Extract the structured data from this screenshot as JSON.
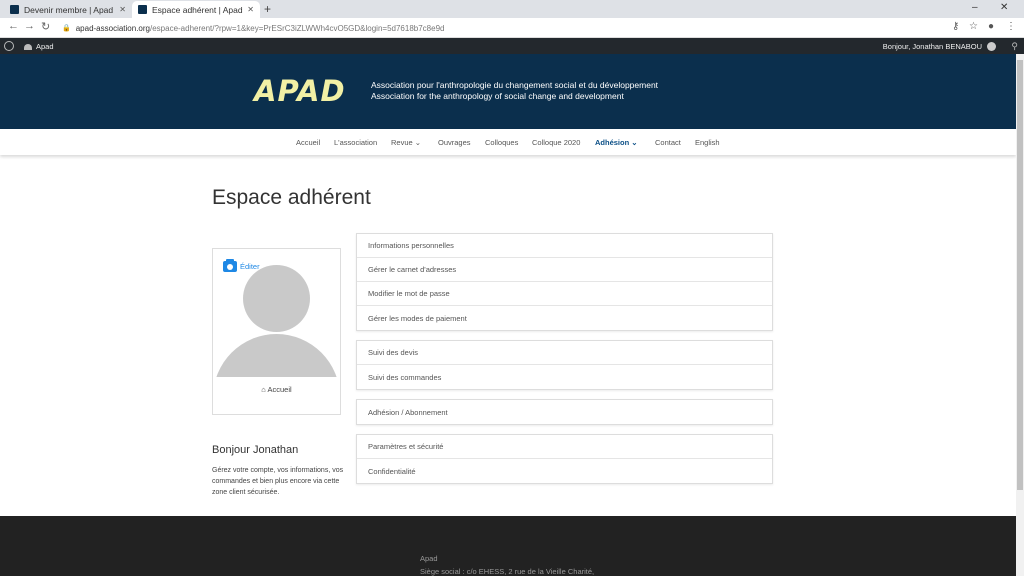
{
  "browser": {
    "tabs": [
      {
        "label": "Devenir membre | Apad"
      },
      {
        "label": "Espace adhérent | Apad"
      }
    ],
    "new_tab": "+",
    "url_host": "apad-association.org",
    "url_path": "/espace-adherent/?rpw=1&key=PrESrC3iZLWWh4cvO5GD&login=5d7618b7c8e9d"
  },
  "adminbar": {
    "site": "Apad",
    "user": "Bonjour, Jonathan BENABOU"
  },
  "header": {
    "logo": "APAD",
    "tagline_fr": "Association pour l'anthropologie du changement social et du développement",
    "tagline_en": "Association for the anthropology of social change and development"
  },
  "menu": {
    "items": [
      {
        "label": "Accueil"
      },
      {
        "label": "L'association"
      },
      {
        "label": "Revue"
      },
      {
        "label": "Ouvrages"
      },
      {
        "label": "Colloques"
      },
      {
        "label": "Colloque 2020"
      },
      {
        "label": "Adhésion"
      },
      {
        "label": "Contact"
      },
      {
        "label": "English"
      }
    ]
  },
  "page": {
    "title": "Espace adhérent",
    "edit_label": "Éditer",
    "home_label": "Accueil",
    "greeting": "Bonjour Jonathan",
    "greeting_text": "Gérez votre compte, vos informations, vos commandes et bien plus encore via cette zone client sécurisée."
  },
  "account_menu": {
    "group1": [
      "Informations personnelles",
      "Gérer le carnet d'adresses",
      "Modifier le mot de passe",
      "Gérer les modes de paiement"
    ],
    "group2": [
      "Suivi des devis",
      "Suivi des commandes"
    ],
    "group3": [
      "Adhésion / Abonnement"
    ],
    "group4": [
      "Paramètres et sécurité",
      "Confidentialité"
    ]
  },
  "footer": {
    "name": "Apad",
    "address": "Siège social : c/o EHESS, 2 rue de la Vieille Charité,"
  },
  "colors": {
    "header_bg": "#0b2f4d",
    "accent": "#0b4f86",
    "logo": "#f2f0a5",
    "adminbar": "#23282d",
    "footer": "#222222"
  }
}
